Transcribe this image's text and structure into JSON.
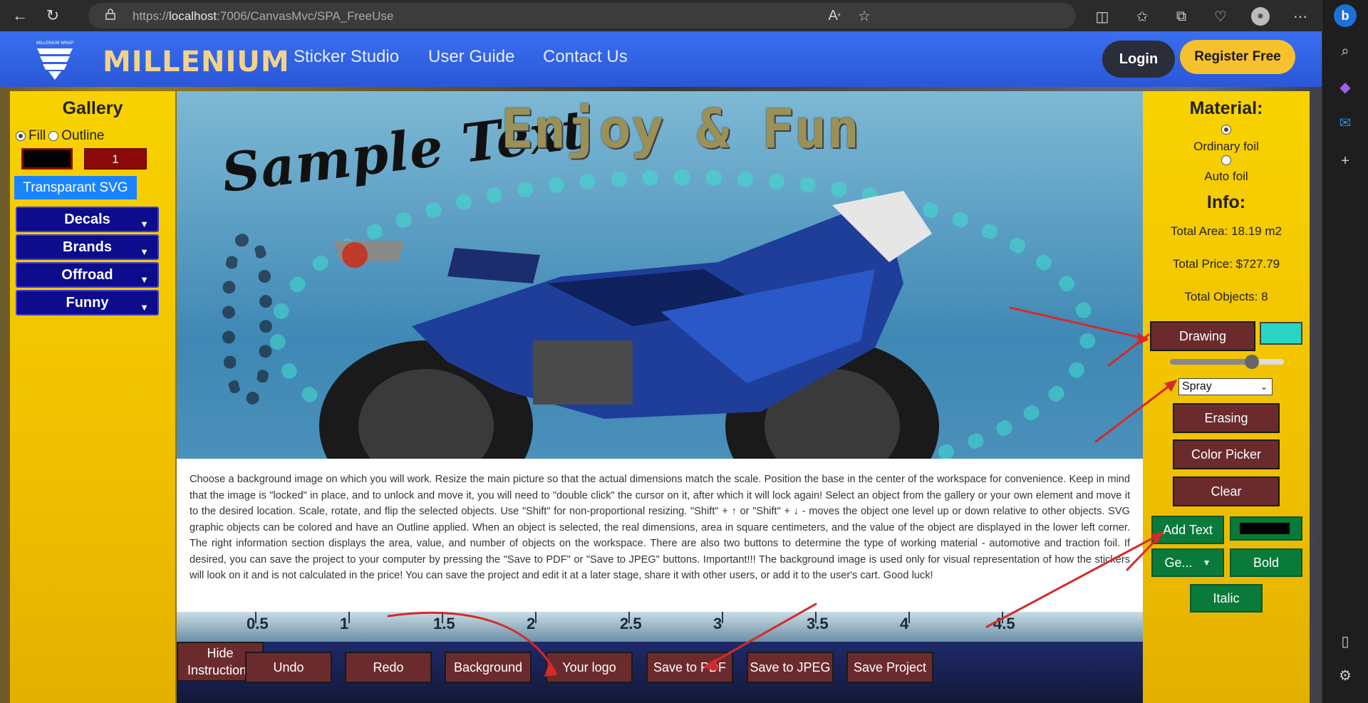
{
  "browser": {
    "url_prefix": "https://",
    "url_host": "localhost",
    "url_rest": ":7006/CanvasMvc/SPA_FreeUse"
  },
  "navbar": {
    "logo_caption": "MILLENIUM WRAP",
    "brand": "MILLENIUM",
    "links": [
      "Sticker Studio",
      "User Guide",
      "Contact Us"
    ],
    "login": "Login",
    "register": "Register Free"
  },
  "gallery": {
    "title": "Gallery",
    "fill_label": "Fill",
    "outline_label": "Outline",
    "fill_selected": true,
    "number_value": "1",
    "transparent_svg": "Transparant SVG",
    "categories": [
      "Decals",
      "Brands",
      "Offroad",
      "Funny"
    ]
  },
  "canvas": {
    "sample_text": "Sample Text",
    "headline_text": "Enjoy & Fun",
    "instructions": "Choose a background image on which you will work. Resize the main picture so that the actual dimensions match the scale. Position the base in the center of the workspace for convenience. Keep in mind that the image is \"locked\" in place, and to unlock and move it, you will need to \"double click\" the cursor on it, after which it will lock again! Select an object from the gallery or your own element and move it to the desired location. Scale, rotate, and flip the selected objects. Use \"Shift\" for non-proportional resizing. \"Shift\" + ↑ or \"Shift\" + ↓ - moves the object one level up or down relative to other objects. SVG graphic objects can be colored and have an Outline applied. When an object is selected, the real dimensions, area in square centimeters, and the value of the object are displayed in the lower left corner. The right information section displays the area, value, and number of objects on the workspace. There are also two buttons to determine the type of working material - automotive and traction foil. If desired, you can save the project to your computer by pressing the \"Save to PDF\" or \"Save to JPEG\" buttons. Important!!! The background image is used only for visual representation of how the stickers will look on it and is not calculated in the price! You can save the project and edit it at a later stage, share it with other users, or add it to the user's cart. Good luck!",
    "ruler_ticks": [
      "0.5",
      "1",
      "1.5",
      "2",
      "2.5",
      "3",
      "3.5",
      "4",
      "4.5"
    ]
  },
  "bottombar": {
    "buttons": [
      "Hide Instructions",
      "Undo",
      "Redo",
      "Background",
      "Your logo",
      "Save to PDF",
      "Save to JPEG",
      "Save Project"
    ]
  },
  "rightpanel": {
    "material_title": "Material:",
    "ordinary_foil": "Ordinary foil",
    "auto_foil": "Auto foil",
    "info_title": "Info:",
    "total_area": "Total Area: 18.19 m2",
    "total_price": "Total Price: $727.79",
    "total_objects": "Total Objects: 8",
    "drawing": "Drawing",
    "brush_level": 0.72,
    "brush_type": "Spray",
    "erasing": "Erasing",
    "color_picker": "Color Picker",
    "clear": "Clear",
    "add_text": "Add Text",
    "font_select": "Ge...",
    "bold": "Bold",
    "italic": "Italic"
  },
  "colors": {
    "brand_gold": "#f3d389",
    "panel_yellow": "#f0c000",
    "button_maroon": "#6b2b2d",
    "button_green": "#0a7a3a",
    "category_blue": "#0c0c8c",
    "draw_color": "#2ad5c4",
    "arrow_red": "#d42a2a"
  },
  "icons": {
    "browser": [
      "back-icon",
      "refresh-icon",
      "lock-icon",
      "read-aloud-icon",
      "favorite-star-icon",
      "split-screen-icon",
      "favorites-icon",
      "collections-icon",
      "performance-icon",
      "profile-avatar",
      "more-icon"
    ],
    "edge_sidebar": [
      "bing-icon",
      "search-icon",
      "copilot-icon",
      "outlook-icon",
      "add-icon",
      "sidebar-toggle-icon",
      "settings-icon"
    ]
  }
}
